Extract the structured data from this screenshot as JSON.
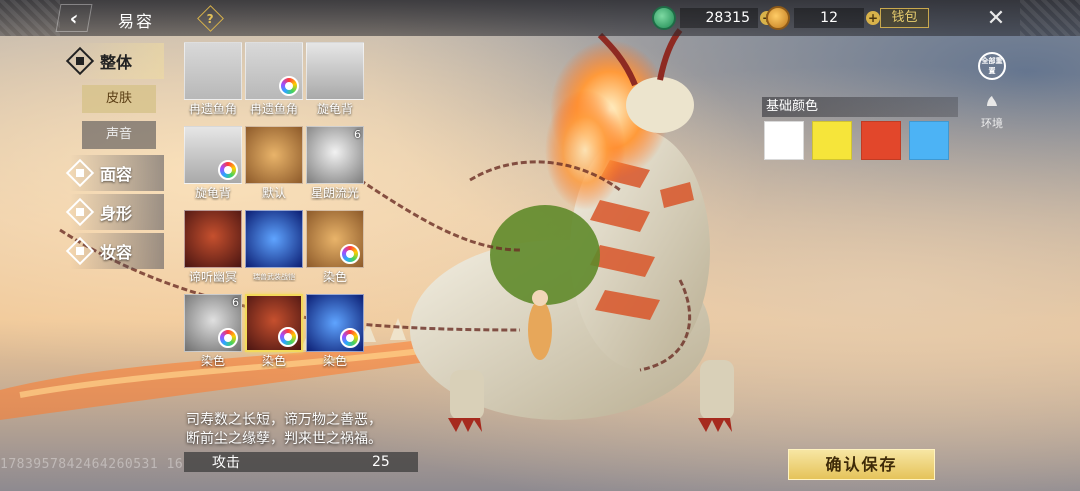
{
  "header": {
    "title": "易容",
    "help_label": "?",
    "jade_amount": "28315",
    "gourd_amount": "12",
    "plus_label": "+",
    "wallet_label": "钱包",
    "back_label": "‹",
    "close_label": "✕"
  },
  "categories": [
    {
      "label": "整体",
      "active": true
    },
    {
      "label": "面容",
      "active": false
    },
    {
      "label": "身形",
      "active": false
    },
    {
      "label": "妆容",
      "active": false
    }
  ],
  "subtabs": [
    {
      "label": "皮肤",
      "active": true
    },
    {
      "label": "声音",
      "active": false
    }
  ],
  "items": [
    {
      "label": "冉遗鱼角",
      "badge": "",
      "palette": false,
      "style": "horn"
    },
    {
      "label": "冉遗鱼角",
      "badge": "",
      "palette": true,
      "style": "horn"
    },
    {
      "label": "旋龟背",
      "badge": "",
      "palette": false,
      "style": "spine"
    },
    {
      "label": "旋龟背",
      "badge": "",
      "palette": true,
      "style": "spine"
    },
    {
      "label": "默认",
      "badge": "",
      "palette": false,
      "style": "face-fox"
    },
    {
      "label": "星朗流光",
      "badge": "6",
      "palette": false,
      "style": "face-silver"
    },
    {
      "label": "谛听幽冥",
      "badge": "",
      "palette": false,
      "style": "face-red"
    },
    {
      "label": "瑞兽武装战铠",
      "badge": "",
      "palette": false,
      "style": "helm-blue"
    },
    {
      "label": "染色",
      "badge": "",
      "palette": true,
      "style": "face-fox"
    },
    {
      "label": "染色",
      "badge": "6",
      "palette": true,
      "style": "face-silver2"
    },
    {
      "label": "染色",
      "badge": "",
      "palette": true,
      "style": "face-red",
      "selected": true
    },
    {
      "label": "染色",
      "badge": "",
      "palette": true,
      "style": "helm-blue"
    }
  ],
  "color_panel": {
    "title": "基础颜色",
    "swatches": [
      "#ffffff",
      "#f6e53a",
      "#e2472b",
      "#4cb3f5"
    ]
  },
  "side_buttons": {
    "reset_label": "全部重置",
    "env_label": "环境"
  },
  "description": {
    "line1": "司寿数之长短，谛万物之善恶，",
    "line2": "断前尘之缘孽，判来世之祸福。"
  },
  "stat": {
    "name": "攻击",
    "value": "25"
  },
  "uid": "1783957842464260531 16",
  "confirm_label": "确认保存",
  "colors": {
    "accent_gold": "#e5c35a",
    "highlight": "#f3da5a"
  }
}
